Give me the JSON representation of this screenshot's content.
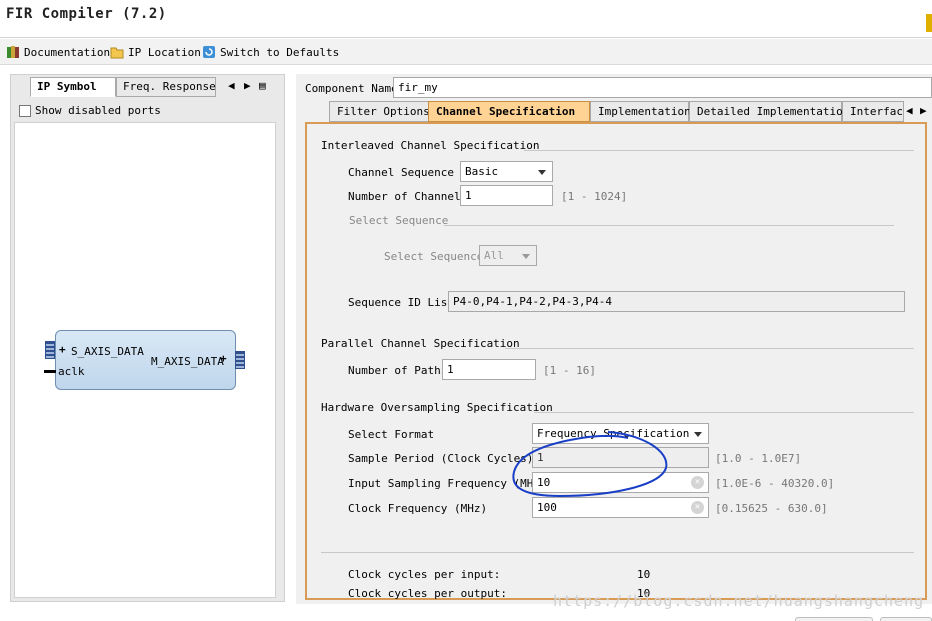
{
  "window": {
    "title": "FIR Compiler (7.2)"
  },
  "toolbar": {
    "documentation": "Documentation",
    "ip_location": "IP Location",
    "switch_defaults": "Switch to Defaults"
  },
  "left_panel": {
    "tabs": [
      "IP Symbol",
      "Freq. Response"
    ],
    "show_disabled_ports": "Show disabled ports",
    "symbol": {
      "in_port": "S_AXIS_DATA",
      "clk_port": "aclk",
      "out_port": "M_AXIS_DATA"
    }
  },
  "component": {
    "label": "Component Name",
    "value": "fir_my"
  },
  "tabs": [
    "Filter Options",
    "Channel Specification",
    "Implementation",
    "Detailed Implementation",
    "Interfac"
  ],
  "interleaved": {
    "title": "Interleaved Channel Specification",
    "channel_sequence_label": "Channel Sequence",
    "channel_sequence_value": "Basic",
    "num_channels_label": "Number of Channels",
    "num_channels_value": "1",
    "num_channels_range": "[1 - 1024]",
    "select_sequence_group": "Select Sequence",
    "select_sequence_label": "Select Sequence",
    "select_sequence_value": "All",
    "sequence_id_label": "Sequence ID List",
    "sequence_id_value": "P4-0,P4-1,P4-2,P4-3,P4-4"
  },
  "parallel": {
    "title": "Parallel Channel Specification",
    "num_paths_label": "Number of Paths",
    "num_paths_value": "1",
    "num_paths_range": "[1 - 16]"
  },
  "oversampling": {
    "title": "Hardware Oversampling Specification",
    "select_format_label": "Select Format",
    "select_format_value": "Frequency Specification",
    "sample_period_label": "Sample Period (Clock Cycles)",
    "sample_period_value": "1",
    "sample_period_range": "[1.0 - 1.0E7]",
    "input_freq_label": "Input Sampling Frequency (MHz)",
    "input_freq_value": "10",
    "input_freq_range": "[1.0E-6 - 40320.0]",
    "clock_freq_label": "Clock Frequency (MHz)",
    "clock_freq_value": "100",
    "clock_freq_range": "[0.15625 - 630.0]"
  },
  "summary": {
    "cycles_per_input_label": "Clock cycles per input:",
    "cycles_per_input_value": "10",
    "cycles_per_output_label": "Clock cycles per output:",
    "cycles_per_output_value": "10"
  },
  "watermark": "https://blog.csdn.net/huangshangcheng",
  "colors": {
    "active_tab": "#ffd394",
    "content_border": "#d89b56",
    "annotation": "#1a3fc7"
  }
}
